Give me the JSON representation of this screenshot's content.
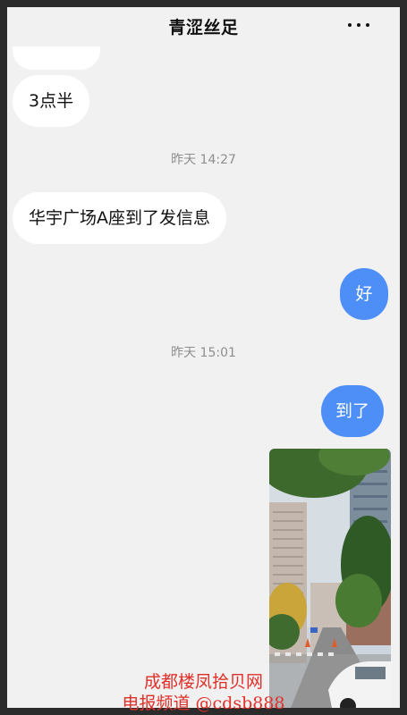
{
  "header": {
    "title": "青涩丝足",
    "more_icon": "more-horizontal-icon"
  },
  "messages": [
    {
      "side": "in",
      "text": "3点半"
    },
    {
      "timestamp": "昨天 14:27"
    },
    {
      "side": "in",
      "text": "华宇广场A座到了发信息"
    },
    {
      "side": "out",
      "text": "好"
    },
    {
      "timestamp": "昨天 15:01"
    },
    {
      "side": "out",
      "text": "到了"
    },
    {
      "side": "out",
      "image": "street-photo-with-high-rise-buildings-and-trees"
    }
  ],
  "watermark": {
    "line1": "成都楼凤拾贝网",
    "line2": "电报频道 @cdsb888"
  },
  "colors": {
    "outgoing_bubble": "#4e8ef7",
    "incoming_bubble": "#ffffff",
    "background": "#f1f1f1",
    "watermark": "#e0302a"
  }
}
